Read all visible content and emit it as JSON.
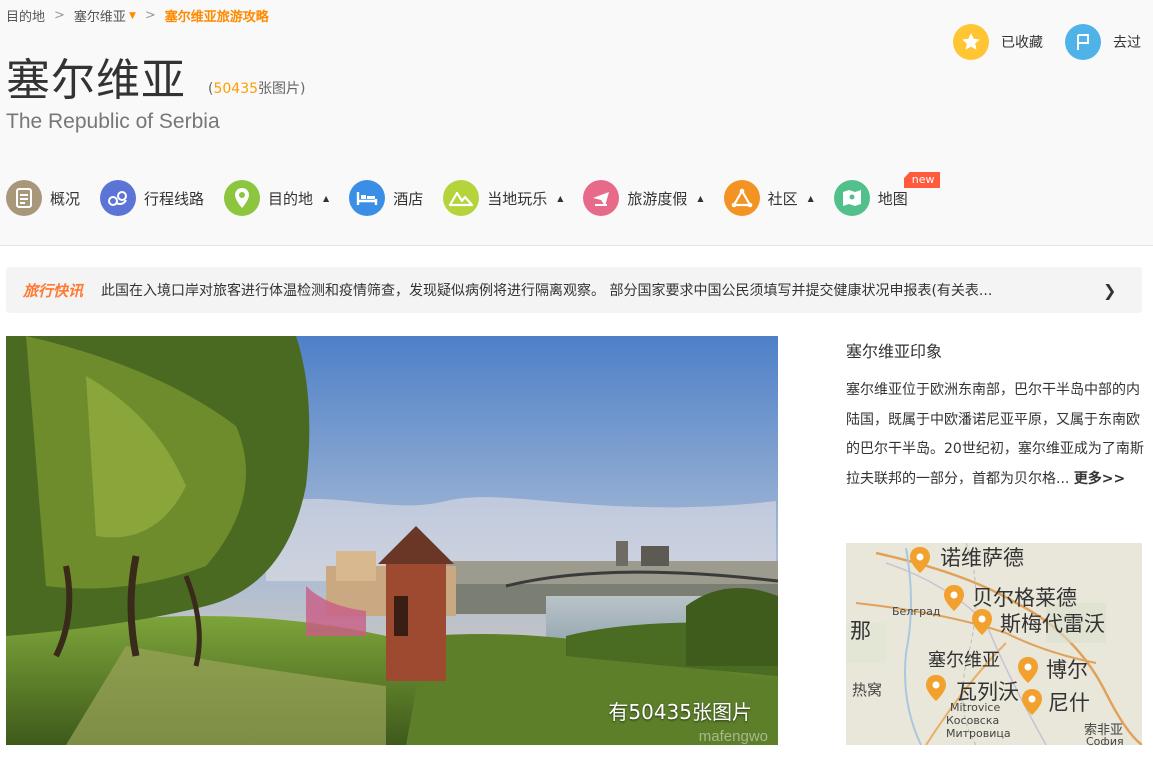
{
  "breadcrumb": {
    "items": [
      "目的地",
      "塞尔维亚"
    ],
    "current": "塞尔维亚旅游攻略"
  },
  "title": "塞尔维亚",
  "photo_count": {
    "open": "(",
    "number": "50435",
    "suffix": "张图片)"
  },
  "subtitle": "The Republic of Serbia",
  "actions": {
    "collected": "已收藏",
    "visited": "去过"
  },
  "nav": {
    "items": [
      {
        "label": "概况",
        "icon": "overview-icon",
        "color": "#a8977a",
        "dropdown": false
      },
      {
        "label": "行程线路",
        "icon": "route-icon",
        "color": "#5b74d6",
        "dropdown": false
      },
      {
        "label": "目的地",
        "icon": "location-pin-icon",
        "color": "#8cc63f",
        "dropdown": true
      },
      {
        "label": "酒店",
        "icon": "bed-icon",
        "color": "#3a8ee6",
        "dropdown": false
      },
      {
        "label": "当地玩乐",
        "icon": "mountain-icon",
        "color": "#b5d33a",
        "dropdown": true
      },
      {
        "label": "旅游度假",
        "icon": "plane-icon",
        "color": "#e86a8a",
        "dropdown": true
      },
      {
        "label": "社区",
        "icon": "community-icon",
        "color": "#f29322",
        "dropdown": true
      },
      {
        "label": "地图",
        "icon": "map-icon",
        "color": "#52c08a",
        "dropdown": false
      }
    ],
    "new_badge": "new"
  },
  "news": {
    "tag": "旅行快讯",
    "text": "此国在入境口岸对旅客进行体温检测和疫情筛查，发现疑似病例将进行隔离观察。 部分国家要求中国公民须填写并提交健康状况申报表(有关表..."
  },
  "hero": {
    "count_label": "有50435张图片",
    "watermark": "mafengwo"
  },
  "impression": {
    "title": "塞尔维亚印象",
    "text": "塞尔维亚位于欧洲东南部，巴尔干半岛中部的内陆国，既属于中欧潘诺尼亚平原，又属于东南欧的巴尔干半岛。20世纪初，塞尔维亚成为了南斯拉夫联邦的一部分，首都为贝尔格...",
    "more": "更多>>"
  },
  "map": {
    "pins": [
      "诺维萨德",
      "贝尔格莱德",
      "斯梅代雷沃",
      "博尔",
      "瓦列沃",
      "尼什"
    ],
    "country": "塞尔维亚",
    "labels": [
      "Белград",
      "Mitrovice",
      "Косовска",
      "Митровица",
      "索非亚",
      "София",
      "那",
      "热窝"
    ]
  },
  "colors": {
    "accent": "#ff8a00",
    "gold": "#ffc533",
    "blue": "#4fb3e8"
  }
}
